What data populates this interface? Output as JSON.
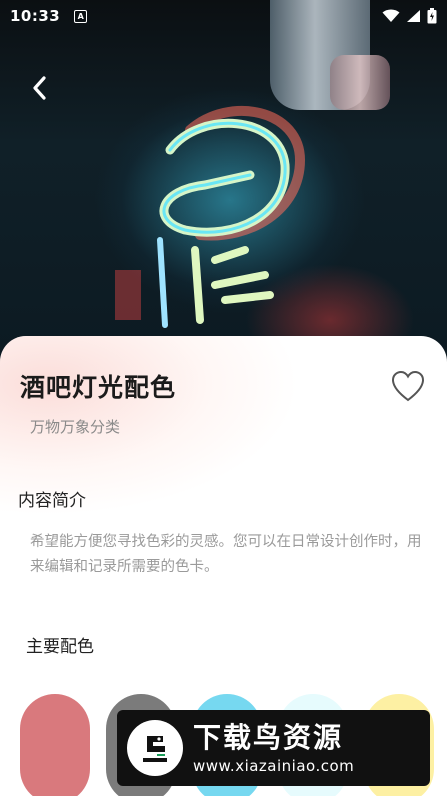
{
  "status_bar": {
    "time": "10:33",
    "notif_badge": "A"
  },
  "detail": {
    "title": "酒吧灯光配色",
    "category": "万物万象分类",
    "intro_heading": "内容简介",
    "intro_text": "希望能方便您寻找色彩的灵感。您可以在日常设计创作时，用来编辑和记录所需要的色卡。",
    "colors_heading": "主要配色",
    "palette": [
      "#d9797d",
      "#7b7b7b",
      "#76d8f0",
      "#e6fbfd",
      "#fdf0a3"
    ]
  },
  "watermark": {
    "title": "下载鸟资源",
    "url": "www.xiazainiao.com"
  },
  "icons": {
    "back": "chevron-left-icon",
    "favorite": "heart-outline-icon",
    "wifi": "wifi-icon",
    "signal": "signal-icon",
    "battery": "battery-icon"
  }
}
